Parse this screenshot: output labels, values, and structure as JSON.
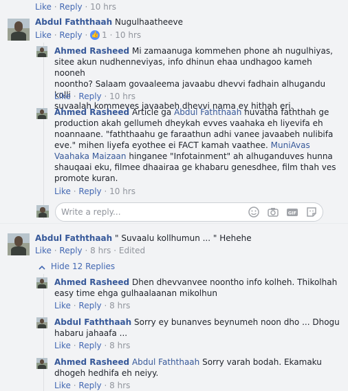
{
  "top_actions": {
    "like": "Like",
    "reply": "Reply",
    "time": "10 hrs"
  },
  "comments": [
    {
      "author": "Abdul Faththaah",
      "text": "Nugulhaatheeve",
      "like": "Like",
      "reply": "Reply",
      "reactions": "1",
      "time": "10 hrs"
    },
    {
      "author": "Abdul Faththaah",
      "text": "\" Suvaalu kollhumun ... \" Hehehe",
      "like": "Like",
      "reply": "Reply",
      "time": "8 hrs",
      "edited": "Edited"
    }
  ],
  "replies": [
    {
      "author": "Ahmed Rasheed",
      "lines": [
        "Mi zamaanuga kommehen phone ah nugulhiyas,",
        "sitee akun nudhenneviyas, info dhinun ehaa undhagoo kameh nooneh",
        "noontho? Salaam govaaleema javaabu dhevvi fadhain alhugandu kolli",
        "suvaalah kommeves javaabeh dhevvi nama ey hithah eri."
      ],
      "like": "Like",
      "reply": "Reply",
      "time": "10 hrs"
    },
    {
      "author": "Ahmed Rasheed",
      "line1_pre": "Article ga",
      "mention1": "Abdul Faththaah",
      "line1_post": "nuvatha faththah ge",
      "lines_mid": [
        "production akah gellumeh dheykah evves vaahaka eh liyevifa eh",
        "noannaane. \"faththaahu ge faraathun adhi vanee javaabeh nulibifa",
        "eve.\" mihen liyefa eyothee ei FACT kamah vaathee."
      ],
      "mention2a": "MuniAvas",
      "mention2b": "Vaahaka Maizaan",
      "line_after_mention": "hinganee \"Infotainment\" ah alhuganduves hunna",
      "lines_end": [
        "shauqaai eku, filmee dhaairaa ge khabaru genesdhee, film thah ves",
        "promote kuran."
      ],
      "like": "Like",
      "reply": "Reply",
      "time": "10 hrs"
    },
    {
      "author": "Ahmed Rasheed",
      "lines": [
        "Dhen dhevvanvee noontho info kolheh. Thikolhah",
        "easy time ehga gulhaalaanan mikolhun"
      ],
      "like": "Like",
      "reply": "Reply",
      "time": "8 hrs"
    },
    {
      "author": "Abdul Faththaah",
      "lines": [
        "Sorry ey bunanves beynumeh noon dho ... Dhogu",
        "habaru jahaafa ..."
      ],
      "like": "Like",
      "reply": "Reply",
      "time": "8 hrs"
    },
    {
      "author": "Ahmed Rasheed",
      "mention": "Abdul Faththaah",
      "line1_post": "Sorry varah bodah. Ekamaku",
      "lines": [
        "dhogeh hedhifa eh neiyy."
      ],
      "like": "Like",
      "reply": "Reply",
      "time": "8 hrs"
    }
  ],
  "reply_input": {
    "placeholder": "Write a reply..."
  },
  "hide_replies": "Hide 12 Replies",
  "separator": "·",
  "icons": [
    "emoji-icon",
    "camera-icon",
    "gif-icon",
    "sticker-icon",
    "thumbs-up-icon",
    "reply-arrow-icon"
  ],
  "colors": {
    "link": "#365899",
    "meta": "#90949c",
    "like_badge": "#5890ff",
    "background": "#f2f3f5"
  }
}
